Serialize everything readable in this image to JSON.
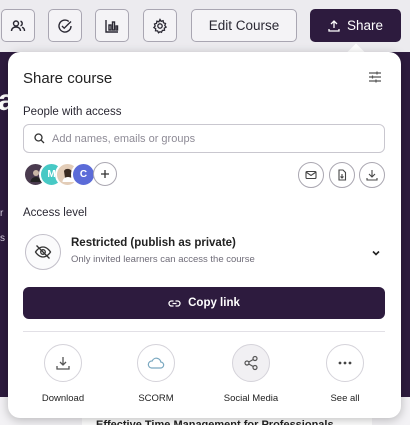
{
  "toolbar": {
    "edit_label": "Edit Course",
    "share_label": "Share",
    "icons": [
      "users-icon",
      "check-circle-icon",
      "bar-chart-icon",
      "gear-icon"
    ]
  },
  "background": {
    "heading_fragment": "a",
    "text_fragment_1": "r",
    "text_fragment_2": "s",
    "card_title": "Effective Time Management for Professionals"
  },
  "share_panel": {
    "title": "Share course",
    "people_label": "People with access",
    "search_placeholder": "Add names, emails or groups",
    "avatars": [
      {
        "initial": "",
        "color": "#4a3b4f"
      },
      {
        "initial": "M",
        "color": "#47c9c5"
      },
      {
        "initial": "",
        "color": "#caa98a"
      },
      {
        "initial": "C",
        "color": "#5b6bd8"
      }
    ],
    "access_level_label": "Access level",
    "access_title": "Restricted (publish as private)",
    "access_subtitle": "Only invited learners can access the course",
    "copy_link_label": "Copy link",
    "actions": [
      {
        "label": "Download",
        "icon": "download-icon"
      },
      {
        "label": "SCORM",
        "icon": "cloud-icon"
      },
      {
        "label": "Social Media",
        "icon": "share-icon"
      },
      {
        "label": "See all",
        "icon": "more-horizontal-icon"
      }
    ]
  },
  "colors": {
    "brand_dark": "#2d1b3e",
    "border": "#a9a6b2"
  }
}
